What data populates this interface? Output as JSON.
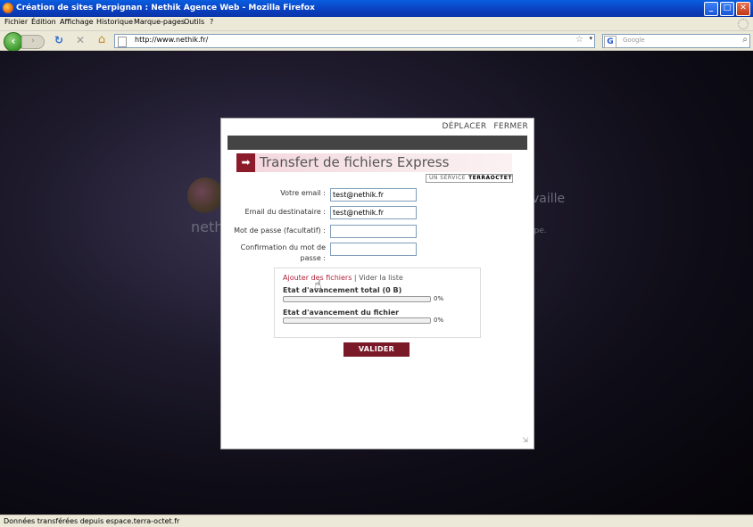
{
  "window": {
    "title": "Création de sites Perpignan : Nethik Agence Web - Mozilla Firefox",
    "controls": {
      "minimize": "_",
      "maximize": "□",
      "close": "✕"
    }
  },
  "menubar": {
    "items": [
      "Fichier",
      "Édition",
      "Affichage",
      "Historique",
      "Marque-pages",
      "Outils",
      "?"
    ]
  },
  "navbar": {
    "back": "‹",
    "forward": "›",
    "reload": "↻",
    "stop": "✕",
    "home": "⌂",
    "url": "http://www.nethik.fr/",
    "star": "☆",
    "url_dropdown": "▾",
    "search_engine": "G",
    "search_placeholder": "Google",
    "search_go": "⌕"
  },
  "background": {
    "brand_text": "nethi",
    "right_text": "vaille",
    "right_subtext": "ipe."
  },
  "modal": {
    "move": "DÉPLACER",
    "close": "FERMER",
    "header_arrow": "➡",
    "title": "Transfert de fichiers Express",
    "service_prefix": "UN SERVICE",
    "service_brand": "TERRAOCTET",
    "form": {
      "email_label": "Votre email :",
      "email_value": "test@nethik.fr",
      "dest_label": "Email du destinataire :",
      "dest_value": "test@nethik.fr",
      "password_label": "Mot de passe (facultatif) :",
      "password_value": "",
      "confirm_label_line1": "Confirmation du mot de",
      "confirm_label_line2": "passe :",
      "confirm_value": ""
    },
    "upload": {
      "add_files": "Ajouter des fichiers",
      "separator": " | ",
      "clear_list": "Vider la liste",
      "total_label": "Etat d'avancement total (0 B)",
      "total_progress": 0,
      "total_percent": "0%",
      "file_label": "Etat d'avancement du fichier",
      "file_progress": 0,
      "file_percent": "0%"
    },
    "submit": "VALIDER",
    "resize": "⇲"
  },
  "status": {
    "text": "Données transférées depuis espace.terra-octet.fr"
  },
  "colors": {
    "accent": "#8b1a2b",
    "title_bar": "#0a3fbe",
    "chrome": "#ece9d8"
  }
}
